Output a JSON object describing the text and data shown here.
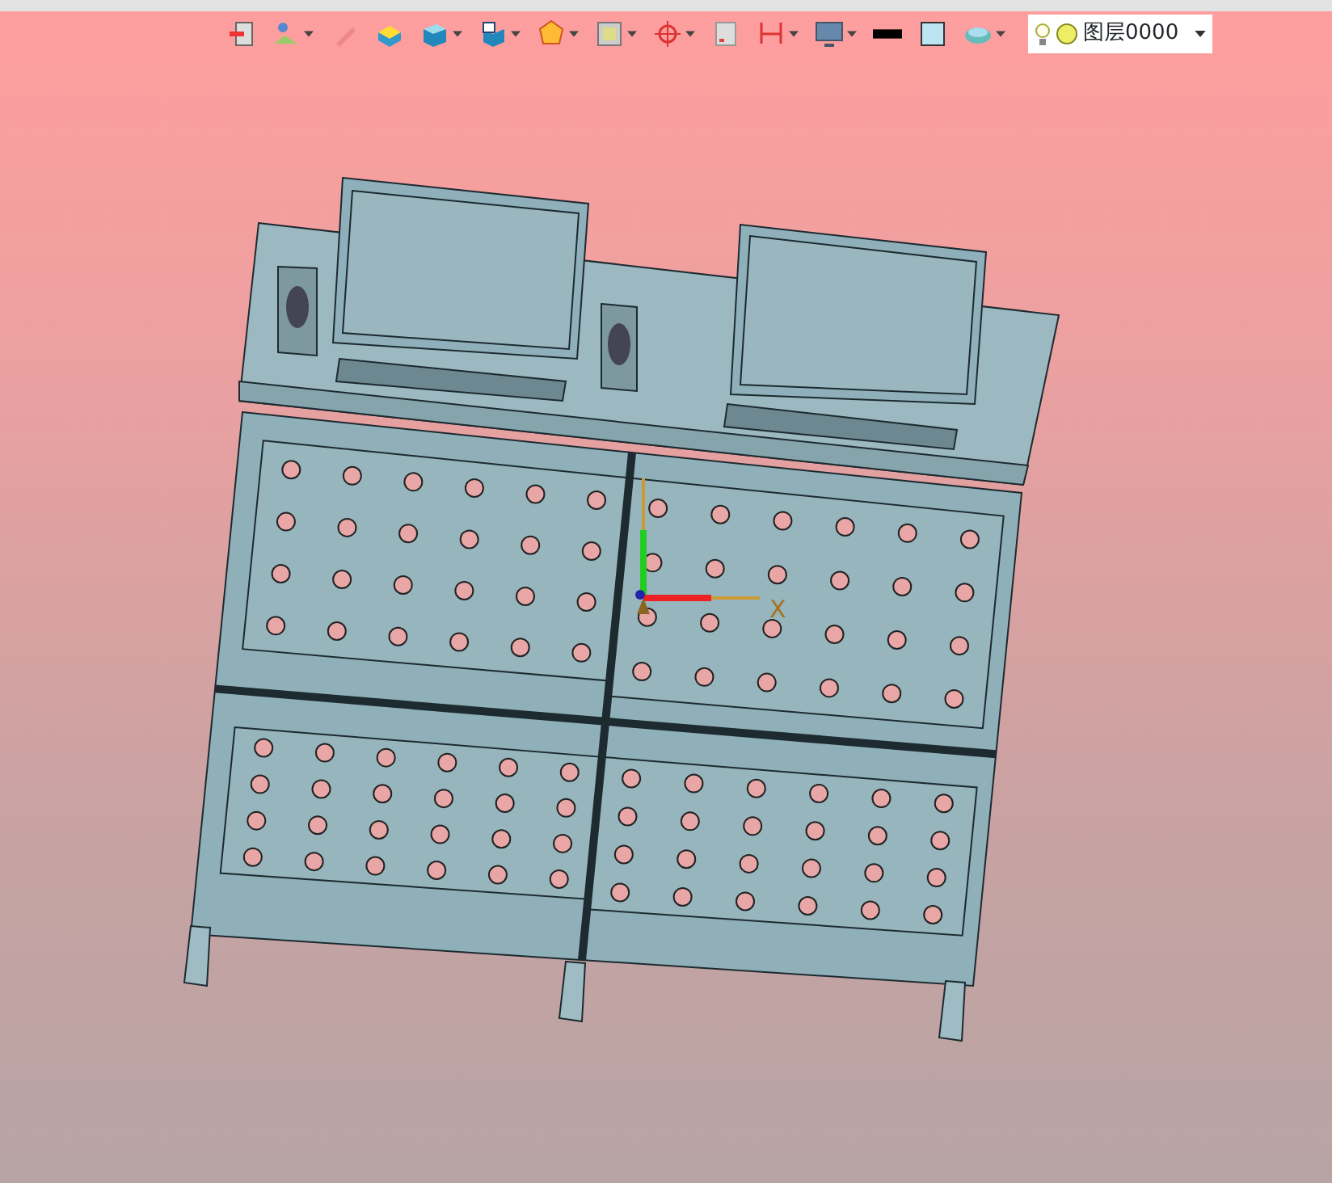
{
  "toolbar": [
    {
      "kind": "exit",
      "dropdown": false
    },
    {
      "kind": "landscape",
      "dropdown": true
    },
    {
      "kind": "pencil",
      "dropdown": false
    },
    {
      "kind": "box",
      "dropdown": false
    },
    {
      "kind": "cube",
      "dropdown": true
    },
    {
      "kind": "cubewin",
      "dropdown": true
    },
    {
      "kind": "polygon",
      "dropdown": true
    },
    {
      "kind": "frame",
      "dropdown": true
    },
    {
      "kind": "crosshair",
      "dropdown": true
    },
    {
      "kind": "square",
      "dropdown": false
    },
    {
      "kind": "dimension",
      "dropdown": true
    },
    {
      "kind": "monitor",
      "dropdown": true
    },
    {
      "kind": "line",
      "dropdown": false
    },
    {
      "kind": "fill",
      "dropdown": false
    },
    {
      "kind": "shape",
      "dropdown": true
    }
  ],
  "layer_selector": {
    "value": "图层0000"
  },
  "viewport": {
    "axis_label": "X"
  }
}
